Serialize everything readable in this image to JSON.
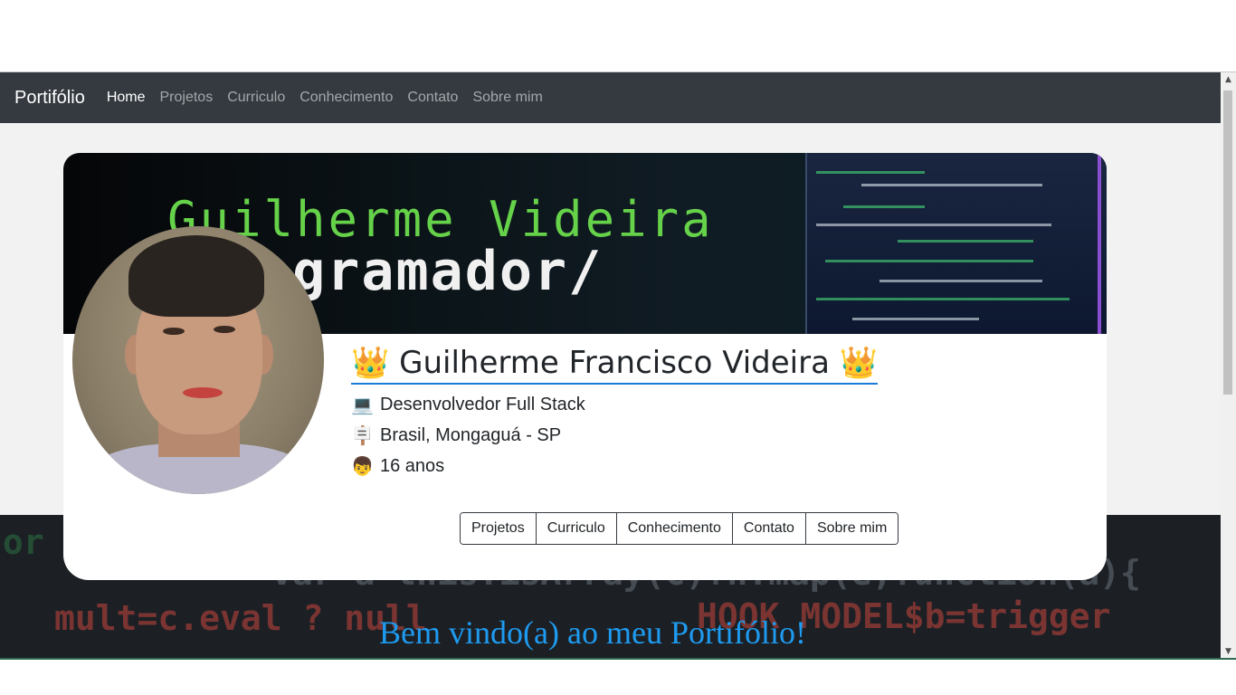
{
  "navbar": {
    "brand": "Portifólio",
    "links": [
      {
        "label": "Home",
        "active": true
      },
      {
        "label": "Projetos",
        "active": false
      },
      {
        "label": "Curriculo",
        "active": false
      },
      {
        "label": "Conhecimento",
        "active": false
      },
      {
        "label": "Contato",
        "active": false
      },
      {
        "label": "Sobre mim",
        "active": false
      }
    ]
  },
  "banner": {
    "name_text": "Guilherme Videira",
    "role_text": "ogramador/"
  },
  "profile": {
    "name": "👑 Guilherme Francisco Videira 👑",
    "details": [
      {
        "icon": "laptop-icon",
        "glyph": "💻",
        "text": "Desenvolvedor Full Stack"
      },
      {
        "icon": "signpost-icon",
        "glyph": "🪧",
        "text": "Brasil, Mongaguá - SP"
      },
      {
        "icon": "boy-face-icon",
        "glyph": "👦",
        "text": "16 anos"
      }
    ]
  },
  "buttons": [
    "Projetos",
    "Curriculo",
    "Conhecimento",
    "Contato",
    "Sobre mim"
  ],
  "welcome": "Bem vindo(a) ao meu Portifólio!",
  "background_code": [
    "var a=this.isArray(c)?n.map(e,function(a){",
    "HOOK MODEL$b=trigger"
  ],
  "colors": {
    "navbar": "#343a40",
    "accent_underline": "#1a7bd8",
    "welcome_text": "#1e9bf0",
    "banner_name": "#66d24a"
  }
}
